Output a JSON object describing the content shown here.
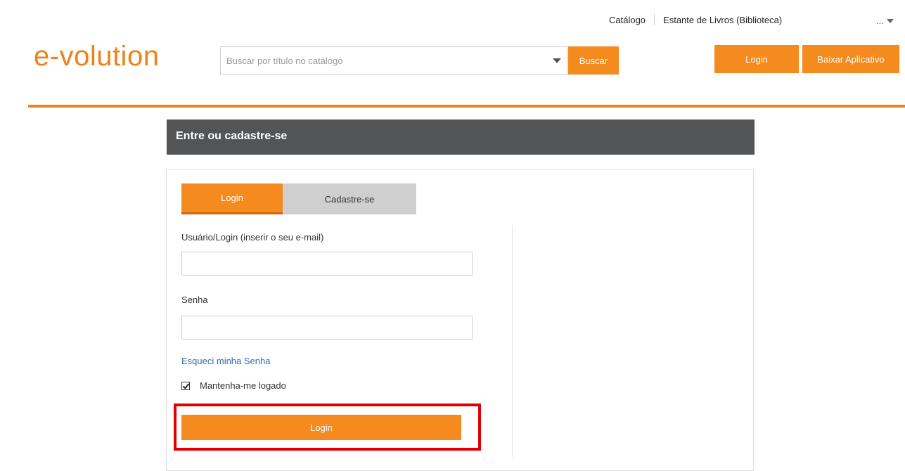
{
  "header": {
    "nav": [
      {
        "label": "Catálogo"
      },
      {
        "label": "Estante de Livros (Biblioteca)"
      }
    ],
    "user_menu_label": "...",
    "logo": "e-volution",
    "search": {
      "placeholder": "Buscar por título no catálogo",
      "button_label": "Buscar"
    },
    "login_label": "Login",
    "download_label": "Baixar Aplicativo"
  },
  "panel": {
    "title": "Entre ou cadastre-se",
    "tabs": [
      {
        "label": "Login",
        "active": true
      },
      {
        "label": "Cadastre-se",
        "active": false
      }
    ],
    "username_label": "Usuário/Login (inserir o seu e-mail)",
    "username_value": "",
    "password_label": "Senha",
    "password_value": "",
    "forgot_label": "Esqueci minha Senha",
    "remember_label": "Mantenha-me logado",
    "remember_checked": true,
    "submit_label": "Login"
  },
  "colors": {
    "accent": "#f58a1f",
    "header_bar": "#535456",
    "highlight": "#e00000",
    "link": "#2d6fb0"
  }
}
